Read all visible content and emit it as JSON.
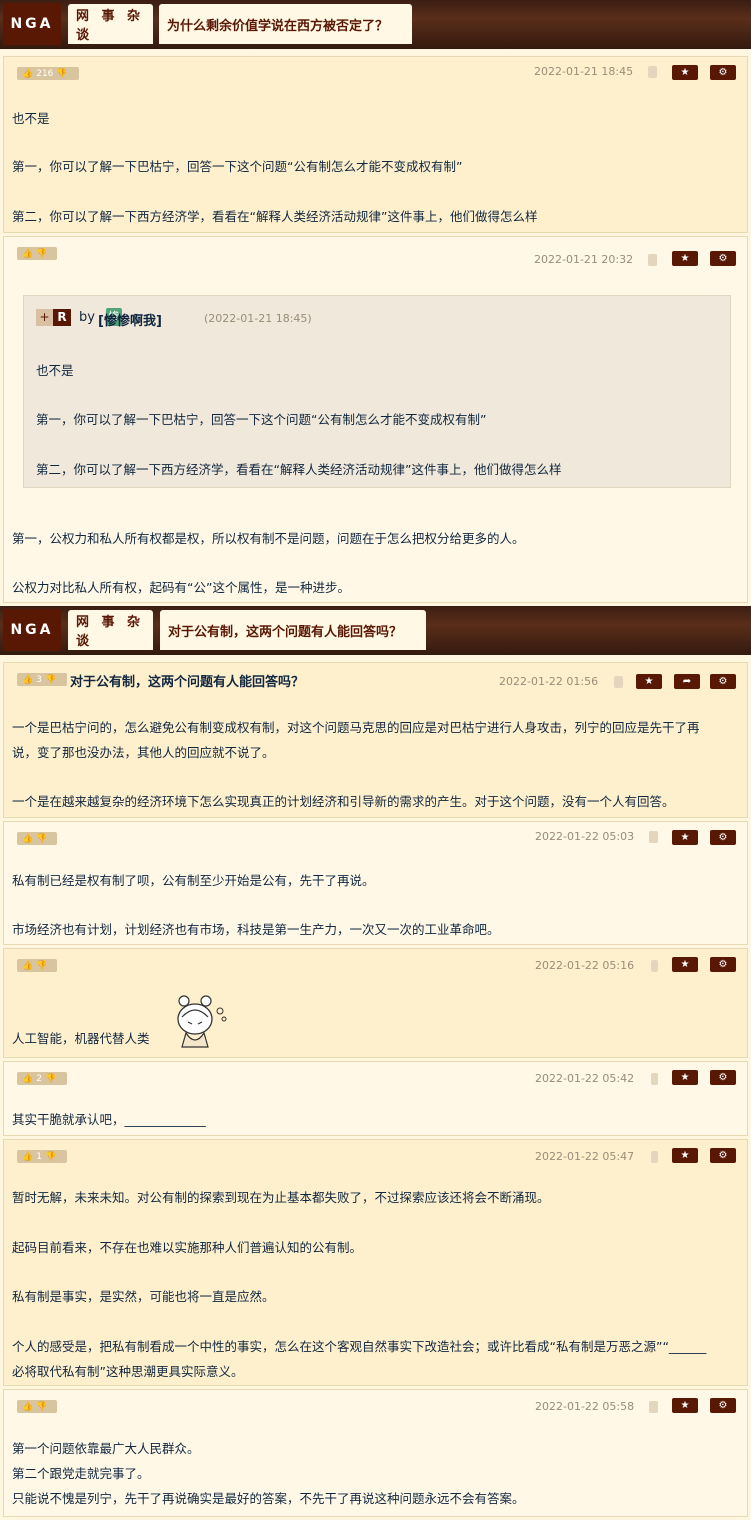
{
  "header1": {
    "logo": "NGA",
    "forum": "网 事 杂 谈",
    "title": "为什么剩余价值学说在西方被否定了？"
  },
  "header2": {
    "logo": "NGA",
    "forum": "网 事 杂 谈",
    "title": "对于公有制，这两个问题有人能回答吗？"
  },
  "thread1": [
    {
      "likes": "216",
      "time": "2022-01-21 18:45",
      "lines": [
        "也不是",
        "第一，你可以了解一下巴枯宁，回答一下这个问题“公有制怎么才能不变成权有制”",
        "第二，你可以了解一下西方经济学，看看在“解释人类经济活动规律”这件事上，他们做得怎么样"
      ]
    },
    {
      "likes": "",
      "time": "2022-01-21 20:32",
      "quote": {
        "tag_plus": "+",
        "tag_r": "R",
        "by": "by",
        "user_badge": "惨",
        "user": "[惨惨啊我]",
        "time": "(2022-01-21 18:45)",
        "lines": [
          "也不是",
          "第一，你可以了解一下巴枯宁，回答一下这个问题“公有制怎么才能不变成权有制”",
          "第二，你可以了解一下西方经济学，看看在“解释人类经济活动规律”这件事上，他们做得怎么样"
        ]
      },
      "lines": [
        "第一，公权力和私人所有权都是权，所以权有制不是问题，问题在于怎么把权分给更多的人。",
        "公权力对比私人所有权，起码有“公”这个属性，是一种进步。"
      ]
    }
  ],
  "thread2": [
    {
      "likes": "3",
      "title": "对于公有制，这两个问题有人能回答吗？",
      "time": "2022-01-22 01:56",
      "lines": [
        "一个是巴枯宁问的，怎么避免公有制变成权有制，对这个问题马克思的回应是对巴枯宁进行人身攻击，列宁的回应是先干了再",
        "说，变了那也没办法，其他人的回应就不说了。",
        "一个是在越来越复杂的经济环境下怎么实现真正的计划经济和引导新的需求的产生。对于这个问题，没有一个人有回答。"
      ]
    },
    {
      "likes": "",
      "time": "2022-01-22 05:03",
      "lines": [
        "私有制已经是权有制了呗，公有制至少开始是公有，先干了再说。",
        "市场经济也有计划，计划经济也有市场，科技是第一生产力，一次又一次的工业革命吧。"
      ]
    },
    {
      "likes": "",
      "time": "2022-01-22 05:16",
      "lines": [
        "人工智能，机器代替人类"
      ]
    },
    {
      "likes": "2",
      "time": "2022-01-22 05:42",
      "lines": [
        "其实干脆就承认吧，_____________"
      ]
    },
    {
      "likes": "1",
      "time": "2022-01-22 05:47",
      "lines": [
        "暂时无解，未来未知。对公有制的探索到现在为止基本都失败了，不过探索应该还将会不断涌现。",
        "起码目前看来，不存在也难以实施那种人们普遍认知的公有制。",
        "私有制是事实，是实然，可能也将一直是应然。",
        "个人的感受是，把私有制看成一个中性的事实，怎么在这个客观自然事实下改造社会；或许比看成“私有制是万恶之源”“______",
        "必将取代私有制”这种思潮更具实际意义。"
      ]
    },
    {
      "likes": "",
      "time": "2022-01-22 05:58",
      "lines": [
        "第一个问题依靠最广大人民群众。",
        "第二个跟党走就完事了。",
        "只能说不愧是列宁，先干了再说确实是最好的答案，不先干了再说这种问题永远不会有答案。"
      ]
    }
  ],
  "icons": {
    "like": "thumbs-up-icon",
    "dislike": "thumbs-down-icon",
    "favorite": "star-icon",
    "share": "share-icon",
    "settings": "gear-icon",
    "device_android": "android-icon",
    "device_phone": "phone-icon"
  }
}
